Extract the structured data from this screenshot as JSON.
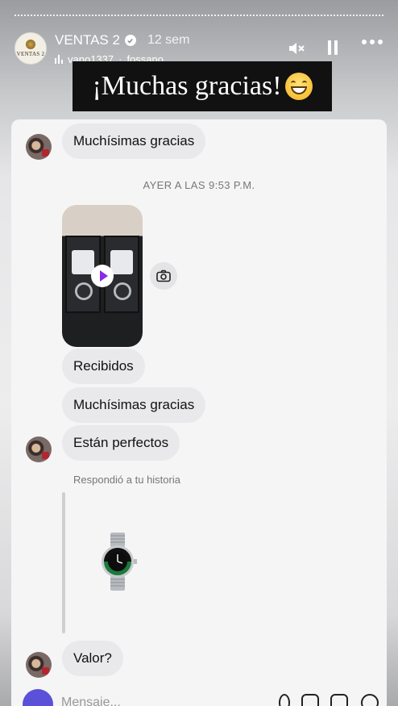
{
  "story": {
    "account_name": "VENTAS 2",
    "logo_text": "VENTAS 2",
    "posted_ago": "12 sem",
    "music_label": "vano1337",
    "music_sep": "·",
    "location": "fossano",
    "caption": "¡Muchas gracias!",
    "controls": {
      "mute": "speaker-muted-icon",
      "pause": "pause-icon",
      "more": "more-icon"
    }
  },
  "chat": {
    "messages": [
      {
        "text": "Muchísimas gracias"
      },
      {
        "timestamp": "AYER A LAS 9:53 P.M."
      },
      {
        "text": "Recibidos"
      },
      {
        "text": "Muchísimas gracias"
      },
      {
        "text": "Están perfectos"
      },
      {
        "reply_label": "Respondió a tu historia"
      },
      {
        "text": "Valor?"
      }
    ]
  },
  "composer": {
    "placeholder": "Mensaje..."
  }
}
